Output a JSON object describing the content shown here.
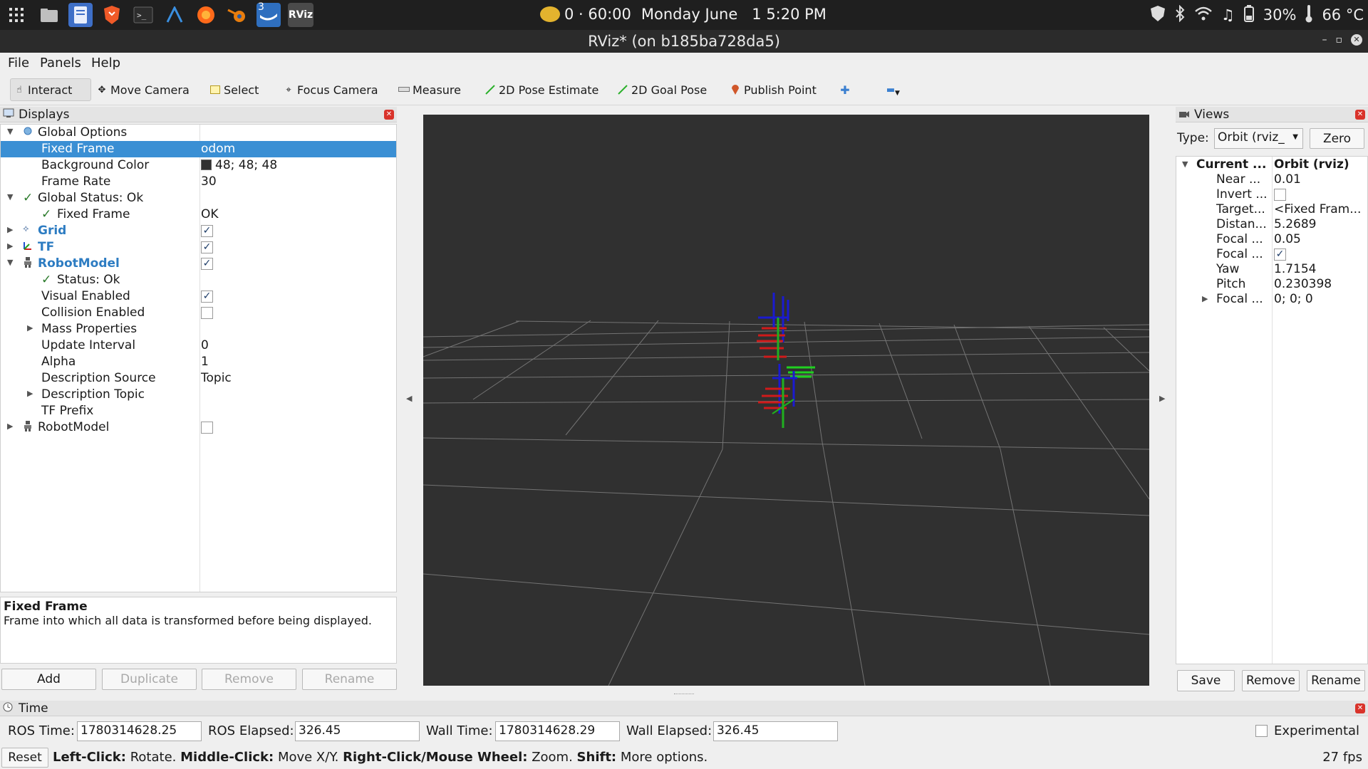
{
  "system_bar": {
    "clock_timer": "0 · 60:00",
    "clock_day": "Monday",
    "clock_date": "June   1",
    "clock_time": "5:20 PM",
    "battery": "30%",
    "temperature": "66 °C",
    "badge_count": "3",
    "rviz_icon": "RViz"
  },
  "window": {
    "title": "RViz* (on b185ba728da5)"
  },
  "menu": {
    "file": "File",
    "panels": "Panels",
    "help": "Help"
  },
  "toolbar": {
    "interact": "Interact",
    "move_camera": "Move Camera",
    "select": "Select",
    "focus_camera": "Focus Camera",
    "measure": "Measure",
    "pose_estimate": "2D Pose Estimate",
    "goal_pose": "2D Goal Pose",
    "publish_point": "Publish Point"
  },
  "displays": {
    "title": "Displays",
    "rows": {
      "global_options": "Global Options",
      "fixed_frame": "Fixed Frame",
      "fixed_frame_val": "odom",
      "bg_color": "Background Color",
      "bg_color_val": "48; 48; 48",
      "frame_rate": "Frame Rate",
      "frame_rate_val": "30",
      "global_status": "Global Status: Ok",
      "status_fixed_frame": "Fixed Frame",
      "status_fixed_frame_val": "OK",
      "grid": "Grid",
      "tf": "TF",
      "robot_model": "RobotModel",
      "rm_status": "Status: Ok",
      "visual_enabled": "Visual Enabled",
      "collision_enabled": "Collision Enabled",
      "mass_properties": "Mass Properties",
      "update_interval": "Update Interval",
      "update_interval_val": "0",
      "alpha": "Alpha",
      "alpha_val": "1",
      "description_source": "Description Source",
      "description_source_val": "Topic",
      "description_topic": "Description Topic",
      "tf_prefix": "TF Prefix",
      "robot_model_2": "RobotModel"
    },
    "description_title": "Fixed Frame",
    "description_text": "Frame into which all data is transformed before being displayed.",
    "buttons": {
      "add": "Add",
      "duplicate": "Duplicate",
      "remove": "Remove",
      "rename": "Rename"
    }
  },
  "views": {
    "title": "Views",
    "type_label": "Type:",
    "type_value": "Orbit (rviz_",
    "zero": "Zero",
    "rows": {
      "current": "Current ...",
      "current_val": "Orbit (rviz)",
      "near": "Near ...",
      "near_val": "0.01",
      "invert": "Invert ...",
      "target": "Target...",
      "target_val": "<Fixed Fram...",
      "distance": "Distan...",
      "distance_val": "5.2689",
      "focal_size": "Focal ...",
      "focal_size_val": "0.05",
      "focal_shape": "Focal ...",
      "yaw": "Yaw",
      "yaw_val": "1.7154",
      "pitch": "Pitch",
      "pitch_val": "0.230398",
      "focal_point": "Focal ...",
      "focal_point_val": "0; 0; 0"
    },
    "buttons": {
      "save": "Save",
      "remove": "Remove",
      "rename": "Rename"
    }
  },
  "time": {
    "title": "Time",
    "ros_time_label": "ROS Time:",
    "ros_time": "1780314628.25",
    "ros_elapsed_label": "ROS Elapsed:",
    "ros_elapsed": "326.45",
    "wall_time_label": "Wall Time:",
    "wall_time": "1780314628.29",
    "wall_elapsed_label": "Wall Elapsed:",
    "wall_elapsed": "326.45",
    "experimental": "Experimental"
  },
  "status": {
    "reset": "Reset",
    "left_click": "Left-Click:",
    "left_click_text": "Rotate.",
    "middle_click": "Middle-Click:",
    "middle_click_text": "Move X/Y.",
    "right_click": "Right-Click/Mouse Wheel:",
    "right_click_text": "Zoom.",
    "shift": "Shift:",
    "shift_text": "More options.",
    "fps": "27 fps"
  },
  "icons": [
    "apps-grid-icon",
    "files-icon",
    "text-editor-icon",
    "brave-icon",
    "terminal-icon",
    "arduino-icon",
    "firefox-icon",
    "blender-icon",
    "docker-icon",
    "rviz-icon",
    "shield-icon",
    "bluetooth-icon",
    "wifi-icon",
    "music-icon",
    "battery-icon",
    "thermometer-icon"
  ],
  "colors": {
    "viewport_bg": "#303030",
    "selection": "#3a8fd4",
    "accent_blue": "#2d7cc2",
    "close_red": "#d9332b"
  }
}
